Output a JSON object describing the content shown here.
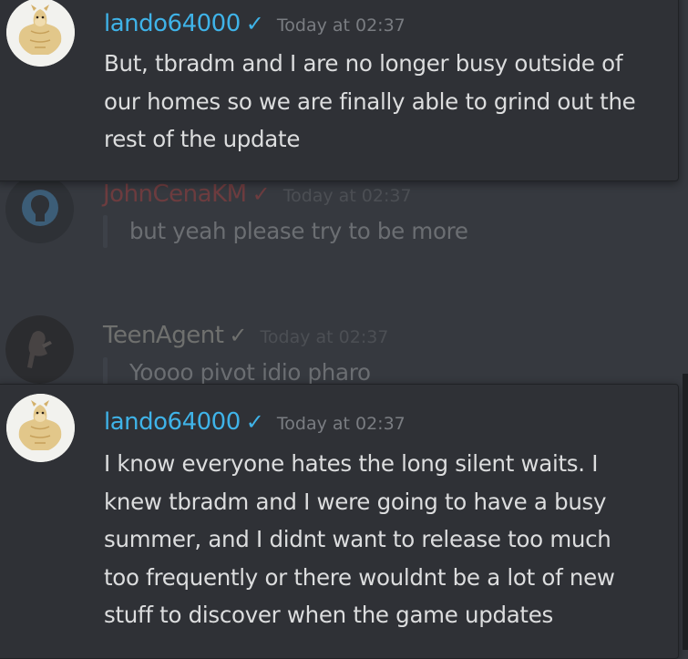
{
  "messages": [
    {
      "author": "lando64000",
      "check": "✓",
      "time": "Today at 02:37",
      "text": "But, tbradm and I are no longer busy outside of our homes so we are finally able to grind out the rest of the update",
      "name_color": "#3fb3e8"
    },
    {
      "author": "JohnCenaKM",
      "check": "✓",
      "time": "Today at 02:37",
      "text": "but yeah please try to be more",
      "name_color": "#e0453f"
    },
    {
      "author": "TeenAgent",
      "check": "✓",
      "time": "Today at 02:37",
      "text": "Yoooo pivot idio pharo",
      "name_color": "#e7e3d0"
    },
    {
      "author": "lando64000",
      "check": "✓",
      "time": "Today at 02:37",
      "text": "I know everyone hates the long silent waits. I knew tbradm and I were going to have a busy summer, and I didnt want to release too much too frequently or there wouldnt be a lot of new stuff to discover when the game updates",
      "name_color": "#3fb3e8"
    }
  ],
  "icons": {
    "doge_avatar": "muscular-doge-avatar",
    "silhouette_avatar": "user-silhouette-avatar",
    "dark_avatar": "dark-figure-avatar"
  }
}
